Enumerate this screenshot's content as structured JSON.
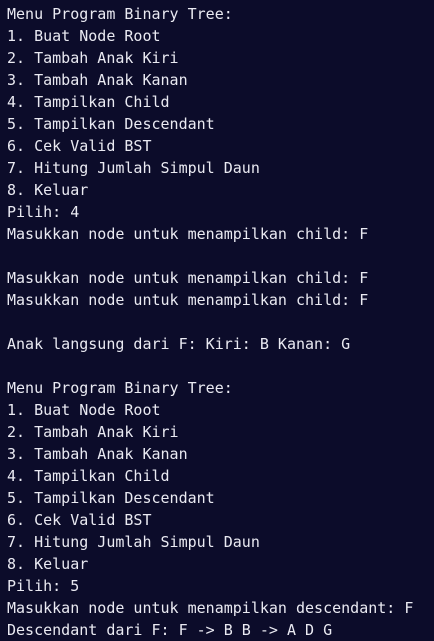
{
  "terminal": {
    "lines": [
      "Menu Program Binary Tree:",
      "1. Buat Node Root",
      "2. Tambah Anak Kiri",
      "3. Tambah Anak Kanan",
      "4. Tampilkan Child",
      "5. Tampilkan Descendant",
      "6. Cek Valid BST",
      "7. Hitung Jumlah Simpul Daun",
      "8. Keluar",
      "Pilih: 4",
      "Masukkan node untuk menampilkan child: F",
      "",
      "Masukkan node untuk menampilkan child: F",
      "Masukkan node untuk menampilkan child: F",
      "",
      "Anak langsung dari F: Kiri: B Kanan: G",
      "",
      "Menu Program Binary Tree:",
      "1. Buat Node Root",
      "2. Tambah Anak Kiri",
      "3. Tambah Anak Kanan",
      "4. Tampilkan Child",
      "5. Tampilkan Descendant",
      "6. Cek Valid BST",
      "7. Hitung Jumlah Simpul Daun",
      "8. Keluar",
      "Pilih: 5",
      "Masukkan node untuk menampilkan descendant: F",
      "Descendant dari F: F -> B B -> A D G"
    ]
  }
}
